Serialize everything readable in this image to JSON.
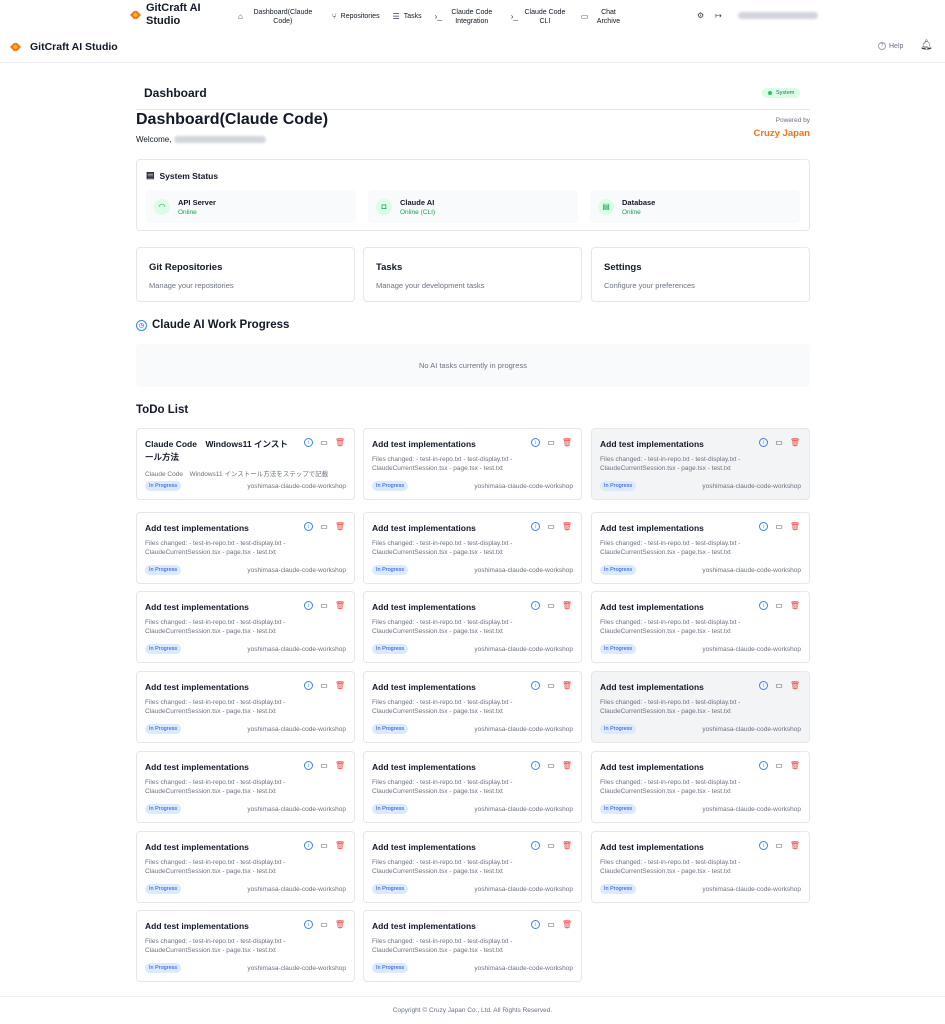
{
  "app": {
    "brand": "GitCraft AI Studio",
    "brand_color": "#f97316"
  },
  "topnav": {
    "items": [
      {
        "label": "Dashboard(Claude Code)",
        "icon": "home-icon"
      },
      {
        "label": "Repositories",
        "icon": "git-branch-icon"
      },
      {
        "label": "Tasks",
        "icon": "list-icon"
      },
      {
        "label": "Claude Code Integration",
        "icon": "terminal-icon"
      },
      {
        "label": "Claude Code CLI",
        "icon": "terminal-icon"
      },
      {
        "label": "Chat Archive",
        "icon": "chat-icon"
      }
    ]
  },
  "subheader": {
    "help": "Help"
  },
  "page": {
    "section_title": "Dashboard",
    "system_badge": "System",
    "title": "Dashboard(Claude Code)",
    "welcome": "Welcome,",
    "powered_by": "Powered by",
    "company": "Cruzy Japan"
  },
  "system_status": {
    "title": "System Status",
    "items": [
      {
        "name": "API Server",
        "status": "Online",
        "icon": "wifi-icon"
      },
      {
        "name": "Claude AI",
        "status": "Online (CLI)",
        "icon": "bot-icon"
      },
      {
        "name": "Database",
        "status": "Online",
        "icon": "database-icon"
      }
    ]
  },
  "nav_cards": [
    {
      "title": "Git Repositories",
      "desc": "Manage your repositories"
    },
    {
      "title": "Tasks",
      "desc": "Manage your development tasks"
    },
    {
      "title": "Settings",
      "desc": "Configure your preferences"
    }
  ],
  "progress": {
    "title": "Claude AI Work Progress",
    "empty": "No AI tasks currently in progress"
  },
  "todo": {
    "title": "ToDo List",
    "items": [
      {
        "title": "Claude Code　Windows11 インストール方法",
        "desc": "Claude Code　Windows11 インストール方法をステップで記載",
        "status": "In Progress",
        "repo": "yoshimasa-claude-code-workshop",
        "highlight": false
      },
      {
        "title": "Add test implementations",
        "desc": "Files changed: - test-in-repo.txt - test-display.txt - ClaudeCurrentSession.tsx - page.tsx - test.txt",
        "status": "In Progress",
        "repo": "yoshimasa-claude-code-workshop",
        "highlight": false
      },
      {
        "title": "Add test implementations",
        "desc": "Files changed: - test-in-repo.txt - test-display.txt - ClaudeCurrentSession.tsx - page.tsx - test.txt",
        "status": "In Progress",
        "repo": "yoshimasa-claude-code-workshop",
        "highlight": true
      },
      {
        "title": "Add test implementations",
        "desc": "Files changed: - test-in-repo.txt - test-display.txt - ClaudeCurrentSession.tsx - page.tsx - test.txt",
        "status": "In Progress",
        "repo": "yoshimasa-claude-code-workshop",
        "highlight": false
      },
      {
        "title": "Add test implementations",
        "desc": "Files changed: - test-in-repo.txt - test-display.txt - ClaudeCurrentSession.tsx - page.tsx - test.txt",
        "status": "In Progress",
        "repo": "yoshimasa-claude-code-workshop",
        "highlight": false
      },
      {
        "title": "Add test implementations",
        "desc": "Files changed: - test-in-repo.txt - test-display.txt - ClaudeCurrentSession.tsx - page.tsx - test.txt",
        "status": "In Progress",
        "repo": "yoshimasa-claude-code-workshop",
        "highlight": false
      },
      {
        "title": "Add test implementations",
        "desc": "Files changed: - test-in-repo.txt - test-display.txt - ClaudeCurrentSession.tsx - page.tsx - test.txt",
        "status": "In Progress",
        "repo": "yoshimasa-claude-code-workshop",
        "highlight": false
      },
      {
        "title": "Add test implementations",
        "desc": "Files changed: - test-in-repo.txt - test-display.txt - ClaudeCurrentSession.tsx - page.tsx - test.txt",
        "status": "In Progress",
        "repo": "yoshimasa-claude-code-workshop",
        "highlight": false
      },
      {
        "title": "Add test implementations",
        "desc": "Files changed: - test-in-repo.txt - test-display.txt - ClaudeCurrentSession.tsx - page.tsx - test.txt",
        "status": "In Progress",
        "repo": "yoshimasa-claude-code-workshop",
        "highlight": false
      },
      {
        "title": "Add test implementations",
        "desc": "Files changed: - test-in-repo.txt - test-display.txt - ClaudeCurrentSession.tsx - page.tsx - test.txt",
        "status": "In Progress",
        "repo": "yoshimasa-claude-code-workshop",
        "highlight": false
      },
      {
        "title": "Add test implementations",
        "desc": "Files changed: - test-in-repo.txt - test-display.txt - ClaudeCurrentSession.tsx - page.tsx - test.txt",
        "status": "In Progress",
        "repo": "yoshimasa-claude-code-workshop",
        "highlight": false
      },
      {
        "title": "Add test implementations",
        "desc": "Files changed: - test-in-repo.txt - test-display.txt - ClaudeCurrentSession.tsx - page.tsx - test.txt",
        "status": "In Progress",
        "repo": "yoshimasa-claude-code-workshop",
        "highlight": true
      },
      {
        "title": "Add test implementations",
        "desc": "Files changed: - test-in-repo.txt - test-display.txt - ClaudeCurrentSession.tsx - page.tsx - test.txt",
        "status": "In Progress",
        "repo": "yoshimasa-claude-code-workshop",
        "highlight": false
      },
      {
        "title": "Add test implementations",
        "desc": "Files changed: - test-in-repo.txt - test-display.txt - ClaudeCurrentSession.tsx - page.tsx - test.txt",
        "status": "In Progress",
        "repo": "yoshimasa-claude-code-workshop",
        "highlight": false
      },
      {
        "title": "Add test implementations",
        "desc": "Files changed: - test-in-repo.txt - test-display.txt - ClaudeCurrentSession.tsx - page.tsx - test.txt",
        "status": "In Progress",
        "repo": "yoshimasa-claude-code-workshop",
        "highlight": false
      },
      {
        "title": "Add test implementations",
        "desc": "Files changed: - test-in-repo.txt - test-display.txt - ClaudeCurrentSession.tsx - page.tsx - test.txt",
        "status": "In Progress",
        "repo": "yoshimasa-claude-code-workshop",
        "highlight": false
      },
      {
        "title": "Add test implementations",
        "desc": "Files changed: - test-in-repo.txt - test-display.txt - ClaudeCurrentSession.tsx - page.tsx - test.txt",
        "status": "In Progress",
        "repo": "yoshimasa-claude-code-workshop",
        "highlight": false
      },
      {
        "title": "Add test implementations",
        "desc": "Files changed: - test-in-repo.txt - test-display.txt - ClaudeCurrentSession.tsx - page.tsx - test.txt",
        "status": "In Progress",
        "repo": "yoshimasa-claude-code-workshop",
        "highlight": false
      },
      {
        "title": "Add test implementations",
        "desc": "Files changed: - test-in-repo.txt - test-display.txt - ClaudeCurrentSession.tsx - page.tsx - test.txt",
        "status": "In Progress",
        "repo": "yoshimasa-claude-code-workshop",
        "highlight": false
      },
      {
        "title": "Add test implementations",
        "desc": "Files changed: - test-in-repo.txt - test-display.txt - ClaudeCurrentSession.tsx - page.tsx - test.txt",
        "status": "In Progress",
        "repo": "yoshimasa-claude-code-workshop",
        "highlight": false
      }
    ]
  },
  "footer": {
    "copyright": "Copyright © Cruzy Japan Co., Ltd. All Rights Reserved."
  }
}
